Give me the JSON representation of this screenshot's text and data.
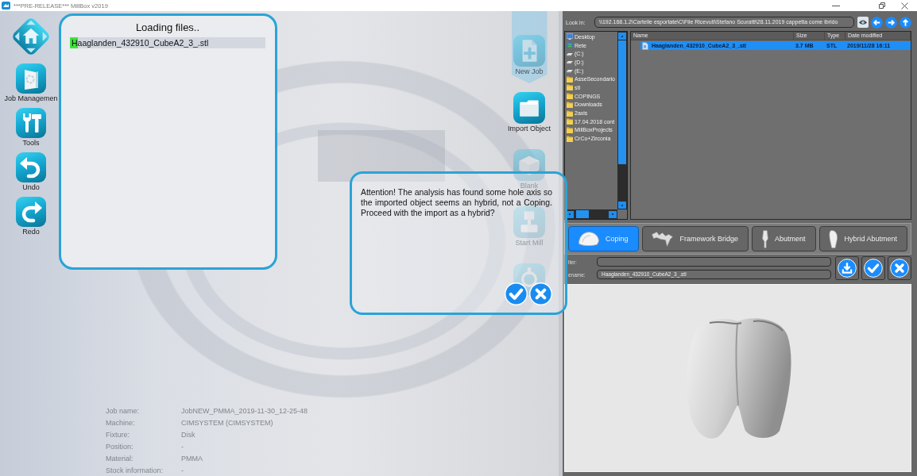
{
  "window": {
    "title": "***PRE-RELEASE*** MillBox v2019"
  },
  "toolbar": [
    {
      "kind": "home"
    },
    {
      "kind": "job-management",
      "label": "Job Managemen"
    },
    {
      "kind": "tools",
      "label": "Tools"
    },
    {
      "kind": "undo",
      "label": "Undo"
    },
    {
      "kind": "redo",
      "label": "Redo"
    }
  ],
  "loading_dialog": {
    "title": "Loading files..",
    "files": [
      {
        "name": "Haaglanden_432910_CubeA2_3_.stl",
        "level": 0.04
      }
    ]
  },
  "workflow": [
    {
      "kind": "new-job",
      "label": "New Job",
      "selected": true,
      "disabled": true
    },
    {
      "kind": "import",
      "label": "Import Object",
      "selected": false,
      "disabled": false
    },
    {
      "kind": "blank",
      "label": "Blank",
      "selected": false,
      "disabled": true
    },
    {
      "kind": "mill",
      "label": "Start Mill",
      "selected": false,
      "disabled": true
    },
    {
      "kind": "machine",
      "selected": false,
      "disabled": true
    }
  ],
  "alert": {
    "message": "Attention! The analysis has found some hole axis so the imported object seems an hybrid, not a Coping. Proceed with the import as a hybrid?",
    "buttons": [
      {
        "kind": "confirm"
      },
      {
        "kind": "cancel"
      }
    ]
  },
  "job_info": [
    {
      "label": "Job name:",
      "value": "JobNEW_PMMA_2019-11-30_12-25-48"
    },
    {
      "label": "Machine:",
      "value": "CIMSYSTEM (CIMSYSTEM)"
    },
    {
      "label": "Fixture:",
      "value": "Disk"
    },
    {
      "label": "Position:",
      "value": "-"
    },
    {
      "label": "Material:",
      "value": "PMMA"
    },
    {
      "label": "Stock information:",
      "value": "-"
    }
  ],
  "file_browser": {
    "look_in": {
      "label": "Look in:",
      "value": "\\\\192.168.1.2\\Cartelle esportate\\C\\File Ricevuti\\Stefano Scuratti\\28.11.2019 cappetta come ibrido"
    },
    "tree": [
      {
        "label": "Desktop",
        "kind": "desktop",
        "selected": false
      },
      {
        "label": "Rete",
        "kind": "network",
        "selected": false
      },
      {
        "label": "(C:)",
        "kind": "drive",
        "selected": false
      },
      {
        "label": "(D:)",
        "kind": "drive",
        "selected": false
      },
      {
        "label": "(E:)",
        "kind": "drive",
        "selected": false
      },
      {
        "label": "AsseSecondario",
        "kind": "folder",
        "selected": false
      },
      {
        "label": "stl",
        "kind": "folder",
        "selected": false
      },
      {
        "label": "COPINGS",
        "kind": "folder",
        "selected": false
      },
      {
        "label": "Downloads",
        "kind": "folder",
        "selected": false
      },
      {
        "label": "2axis",
        "kind": "folder",
        "selected": false
      },
      {
        "label": "17.04.2018 cont",
        "kind": "folder",
        "selected": false
      },
      {
        "label": "MillBoxProjects",
        "kind": "folder",
        "selected": false
      },
      {
        "label": "CrCo+Zirconia",
        "kind": "folder",
        "selected": false
      }
    ],
    "columns": [
      "Name",
      "Size",
      "Type",
      "Date modified"
    ],
    "rows": [
      {
        "cells": [
          "Haaglanden_432910_CubeA2_3_.stl",
          "3.7 MB",
          "STL",
          "2019/11/28 16:11"
        ],
        "selected": true
      }
    ]
  },
  "object_types": [
    {
      "kind": "coping",
      "label": "Coping",
      "selected": true
    },
    {
      "kind": "bridge",
      "label": "Framework Bridge",
      "selected": false
    },
    {
      "kind": "abutment",
      "label": "Abutment",
      "selected": false
    },
    {
      "kind": "hybrid-abutment",
      "label": "Hybrid Abutment",
      "selected": false
    }
  ],
  "fields": [
    {
      "label": "lter:"
    },
    {
      "label": "ename:",
      "value": "Haaglanden_432910_CubeA2_3_.stl"
    }
  ],
  "actions": [
    {
      "kind": "save"
    },
    {
      "kind": "confirm"
    },
    {
      "kind": "cancel"
    }
  ]
}
